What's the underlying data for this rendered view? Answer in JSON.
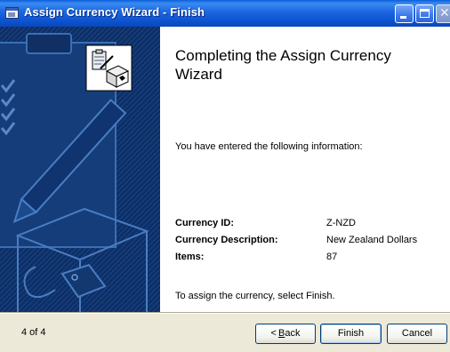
{
  "window": {
    "title": "Assign Currency Wizard - Finish"
  },
  "banner": {
    "icon": "wizard-clipboard-box-icon"
  },
  "main": {
    "heading": "Completing the Assign Currency Wizard",
    "intro": "You have entered the following information:",
    "fields": [
      {
        "label": "Currency ID:",
        "value": "Z-NZD"
      },
      {
        "label": "Currency Description:",
        "value": "New Zealand Dollars"
      },
      {
        "label": "Items:",
        "value": "87"
      }
    ],
    "hint": "To assign the currency, select Finish."
  },
  "footer": {
    "page_indicator": "4 of 4",
    "back_arrow": "<",
    "back_accel": "B",
    "back_rest": "ack",
    "finish_label": "Finish",
    "cancel_label": "Cancel"
  },
  "colors": {
    "titlebar": "#0c52cf",
    "banner": "#0d2f66",
    "footer": "#ece9d8"
  }
}
